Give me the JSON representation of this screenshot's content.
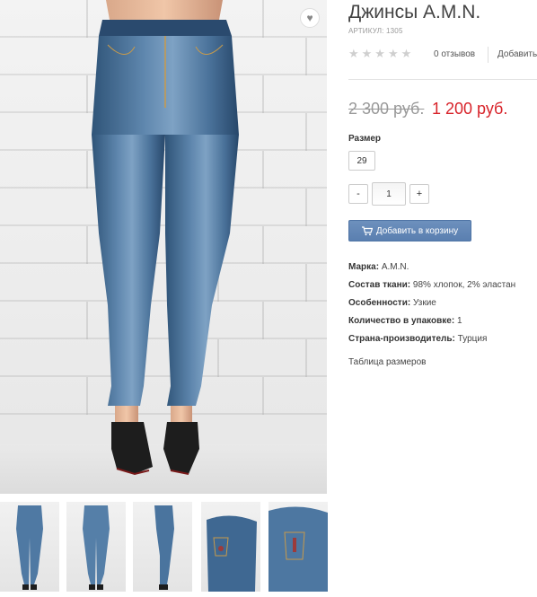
{
  "product": {
    "title": "Джинсы A.M.N.",
    "sku": "АРТИКУЛ: 1305",
    "stars_glyph": "★★★★★",
    "reviews_label": "0 отзывов",
    "add_review_label": "Добавить",
    "rating": 0,
    "rating_max": 5
  },
  "price": {
    "old": "2 300 руб.",
    "new": "1 200 руб.",
    "new_color": "#d8232a"
  },
  "size": {
    "label": "Размер",
    "options": [
      "29"
    ]
  },
  "quantity": {
    "minus": "-",
    "value": "1",
    "plus": "+"
  },
  "cart": {
    "label": "Добавить в корзину",
    "color": "#5f83b3"
  },
  "specs": [
    {
      "name": "Марка:",
      "value": "A.M.N."
    },
    {
      "name": "Состав ткани:",
      "value": "98% хлопок, 2% эластан"
    },
    {
      "name": "Особенности:",
      "value": "Узкие"
    },
    {
      "name": "Количество в упаковке:",
      "value": "1"
    },
    {
      "name": "Страна-производитель:",
      "value": "Турция"
    }
  ],
  "size_chart_link": "Таблица размеров",
  "gallery": {
    "favorite_icon": "heart-icon",
    "thumbnails": [
      "front-view",
      "front-view-2",
      "side-view",
      "back-pocket-view",
      "back-pocket-detail"
    ]
  }
}
